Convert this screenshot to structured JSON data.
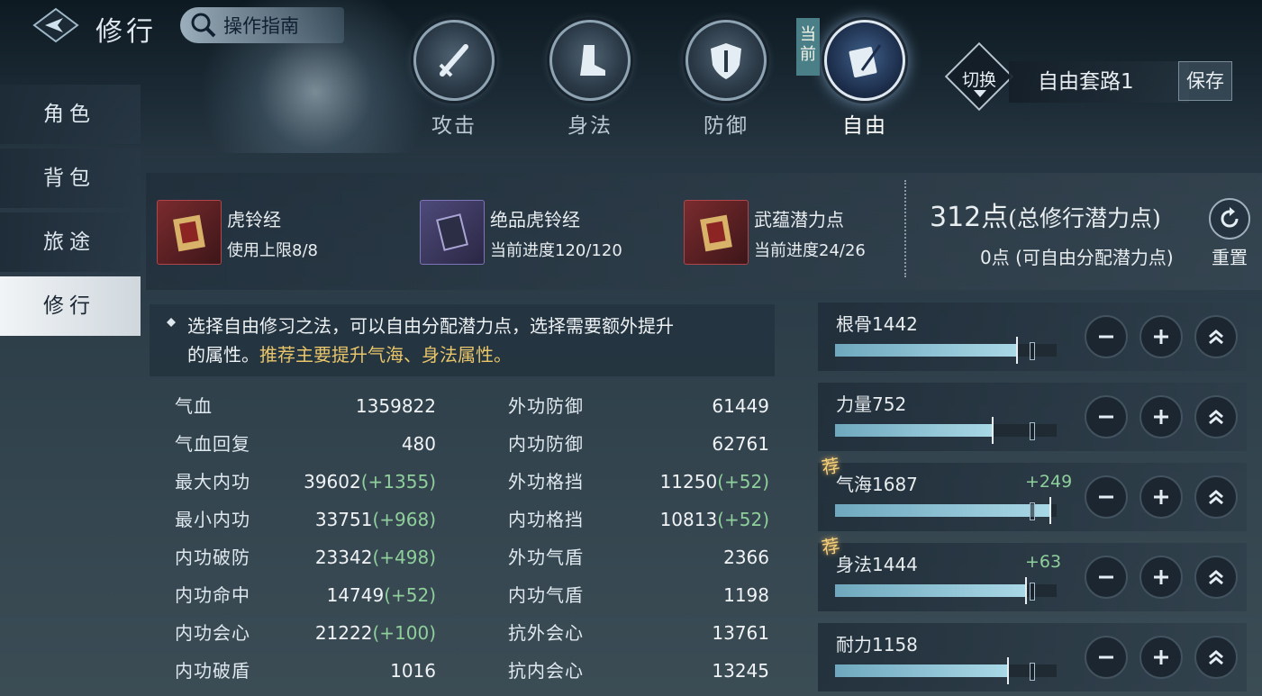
{
  "header": {
    "title": "修行",
    "guide_label": "操作指南"
  },
  "tabs": [
    {
      "label": "攻击",
      "icon": "sword-icon"
    },
    {
      "label": "身法",
      "icon": "boot-icon"
    },
    {
      "label": "防御",
      "icon": "shield-icon"
    },
    {
      "label": "自由",
      "icon": "book-quill-icon",
      "active": true
    }
  ],
  "current_badge": "当前",
  "preset": {
    "switch_label": "切换",
    "name": "自由套路1",
    "save_label": "保存"
  },
  "sidebar": {
    "items": [
      {
        "label": "角色"
      },
      {
        "label": "背包"
      },
      {
        "label": "旅途"
      },
      {
        "label": "修行",
        "active": true
      }
    ]
  },
  "items": [
    {
      "name": "虎铃经",
      "desc": "使用上限8/8"
    },
    {
      "name": "绝品虎铃经",
      "desc": "当前进度120/120"
    },
    {
      "name": "武蕴潜力点",
      "desc": "当前进度24/26"
    }
  ],
  "points": {
    "total_value": "312点",
    "total_label": "(总修行潜力点)",
    "free_text": "0点 (可自由分配潜力点)",
    "reset_label": "重置"
  },
  "description": {
    "line1": "选择自由修习之法，可以自由分配潜力点，选择需要额外提升",
    "line2_plain": "的属性。",
    "line2_highlight": "推荐主要提升气海、身法属性。"
  },
  "stats_left": [
    {
      "label": "气血",
      "value": "1359822",
      "bonus": ""
    },
    {
      "label": "气血回复",
      "value": "480",
      "bonus": ""
    },
    {
      "label": "最大内功",
      "value": "39602",
      "bonus": "(+1355)"
    },
    {
      "label": "最小内功",
      "value": "33751",
      "bonus": "(+968)"
    },
    {
      "label": "内功破防",
      "value": "23342",
      "bonus": "(+498)"
    },
    {
      "label": "内功命中",
      "value": "14749",
      "bonus": "(+52)"
    },
    {
      "label": "内功会心",
      "value": "21222",
      "bonus": "(+100)"
    },
    {
      "label": "内功破盾",
      "value": "1016",
      "bonus": ""
    }
  ],
  "stats_right": [
    {
      "label": "外功防御",
      "value": "61449",
      "bonus": ""
    },
    {
      "label": "内功防御",
      "value": "62761",
      "bonus": ""
    },
    {
      "label": "外功格挡",
      "value": "11250",
      "bonus": "(+52)"
    },
    {
      "label": "内功格挡",
      "value": "10813",
      "bonus": "(+52)"
    },
    {
      "label": "外功气盾",
      "value": "2366",
      "bonus": ""
    },
    {
      "label": "内功气盾",
      "value": "1198",
      "bonus": ""
    },
    {
      "label": "抗外会心",
      "value": "13761",
      "bonus": ""
    },
    {
      "label": "抗内会心",
      "value": "13245",
      "bonus": ""
    }
  ],
  "attributes": [
    {
      "label": "根骨1442",
      "plus": "",
      "recommended": false,
      "fill_fraction": 0.82
    },
    {
      "label": "力量752",
      "plus": "",
      "recommended": false,
      "fill_fraction": 0.71
    },
    {
      "label": "气海1687",
      "plus": "+249",
      "recommended": true,
      "fill_fraction": 0.97
    },
    {
      "label": "身法1444",
      "plus": "+63",
      "recommended": true,
      "fill_fraction": 0.86
    },
    {
      "label": "耐力1158",
      "plus": "",
      "recommended": false,
      "fill_fraction": 0.78
    }
  ],
  "recommend_mark": "荐",
  "colors": {
    "bonus_green": "#8fcf9b",
    "highlight_gold": "#e8c56a",
    "bar_fill": "#a9d8e6"
  }
}
